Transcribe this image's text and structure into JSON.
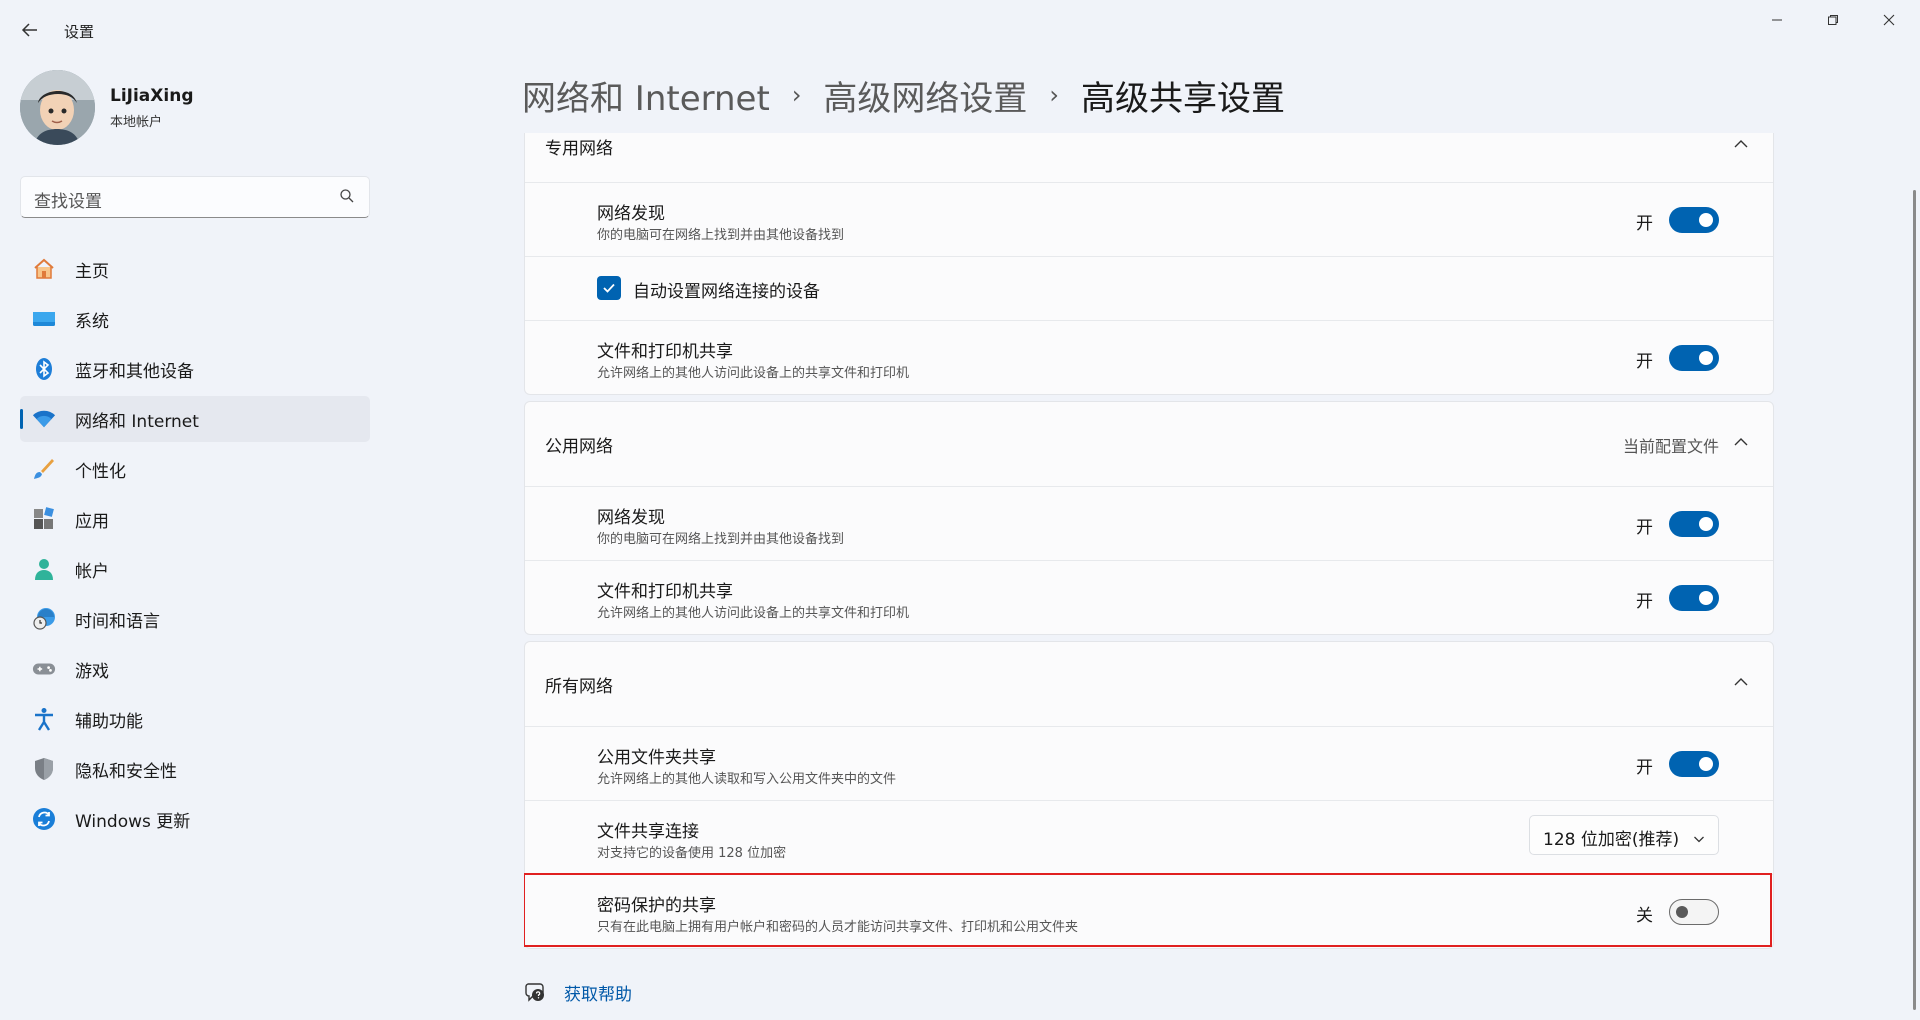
{
  "window": {
    "title": "设置",
    "back_icon": "back-arrow-icon",
    "controls": [
      "minimize-icon",
      "restore-icon",
      "close-icon"
    ]
  },
  "profile": {
    "name": "LiJiaXing",
    "account_type": "本地帐户"
  },
  "search": {
    "placeholder": "查找设置"
  },
  "sidebar": {
    "items": [
      {
        "label": "主页",
        "icon": "home-icon"
      },
      {
        "label": "系统",
        "icon": "monitor-icon"
      },
      {
        "label": "蓝牙和其他设备",
        "icon": "bluetooth-icon"
      },
      {
        "label": "网络和 Internet",
        "icon": "wifi-icon",
        "active": true
      },
      {
        "label": "个性化",
        "icon": "brush-icon"
      },
      {
        "label": "应用",
        "icon": "apps-icon"
      },
      {
        "label": "帐户",
        "icon": "person-icon"
      },
      {
        "label": "时间和语言",
        "icon": "globe-clock-icon"
      },
      {
        "label": "游戏",
        "icon": "gamepad-icon"
      },
      {
        "label": "辅助功能",
        "icon": "accessibility-icon"
      },
      {
        "label": "隐私和安全性",
        "icon": "shield-icon"
      },
      {
        "label": "Windows 更新",
        "icon": "update-icon"
      }
    ]
  },
  "breadcrumb": {
    "items": [
      "网络和 Internet",
      "高级网络设置",
      "高级共享设置"
    ],
    "separator": "›"
  },
  "groups": {
    "private": {
      "title": "专用网络",
      "network_discovery": {
        "title": "网络发现",
        "sub": "你的电脑可在网络上找到并由其他设备找到",
        "state": "开",
        "on": true
      },
      "auto_setup": {
        "label": "自动设置网络连接的设备",
        "checked": true
      },
      "file_printer": {
        "title": "文件和打印机共享",
        "sub": "允许网络上的其他人访问此设备上的共享文件和打印机",
        "state": "开",
        "on": true
      }
    },
    "public": {
      "title": "公用网络",
      "meta": "当前配置文件",
      "network_discovery": {
        "title": "网络发现",
        "sub": "你的电脑可在网络上找到并由其他设备找到",
        "state": "开",
        "on": true
      },
      "file_printer": {
        "title": "文件和打印机共享",
        "sub": "允许网络上的其他人访问此设备上的共享文件和打印机",
        "state": "开",
        "on": true
      }
    },
    "all": {
      "title": "所有网络",
      "public_folder": {
        "title": "公用文件夹共享",
        "sub": "允许网络上的其他人读取和写入公用文件夹中的文件",
        "state": "开",
        "on": true
      },
      "file_sharing_conn": {
        "title": "文件共享连接",
        "sub": "对支持它的设备使用 128 位加密",
        "value": "128 位加密(推荐)"
      },
      "password_protected": {
        "title": "密码保护的共享",
        "sub": "只有在此电脑上拥有用户帐户和密码的人员才能访问共享文件、打印机和公用文件夹",
        "state": "关",
        "on": false
      }
    }
  },
  "help": {
    "label": "获取帮助"
  },
  "colors": {
    "accent": "#0063b1",
    "highlight_box": "#e02020",
    "background": "#f0f3f9"
  }
}
